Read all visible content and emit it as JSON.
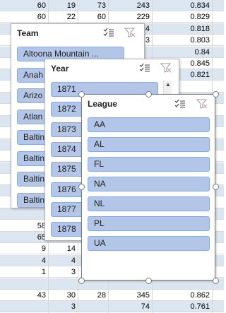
{
  "grid": {
    "rows": [
      {
        "c1": "60",
        "c2": "19",
        "c3": "73",
        "c4": "243",
        "c5": "0.834"
      },
      {
        "c1": "60",
        "c2": "22",
        "c3": "60",
        "c4": "229",
        "c5": "0.829"
      },
      {
        "c1": "",
        "c2": "",
        "c3": "",
        "c4": "4",
        "c5": "0.818"
      },
      {
        "c1": "",
        "c2": "",
        "c3": "",
        "c4": "3",
        "c5": "0.803"
      },
      {
        "c1": "",
        "c2": "",
        "c3": "",
        "c4": "",
        "c5": "0.84"
      },
      {
        "c1": "",
        "c2": "",
        "c3": "",
        "c4": "",
        "c5": "0.845"
      },
      {
        "c1": "",
        "c2": "",
        "c3": "",
        "c4": "",
        "c5": "0.821"
      },
      {
        "c1": "",
        "c2": "",
        "c3": "",
        "c4": "",
        "c5": ""
      },
      {
        "c1": "",
        "c2": "",
        "c3": "",
        "c4": "",
        "c5": ""
      },
      {
        "c1": "",
        "c2": "",
        "c3": "",
        "c4": "",
        "c5": ""
      },
      {
        "c1": "",
        "c2": "",
        "c3": "",
        "c4": "",
        "c5": ""
      },
      {
        "c1": "",
        "c2": "",
        "c3": "",
        "c4": "",
        "c5": ""
      },
      {
        "c1": "",
        "c2": "",
        "c3": "",
        "c4": "",
        "c5": ""
      },
      {
        "c1": "",
        "c2": "",
        "c3": "",
        "c4": "",
        "c5": ""
      },
      {
        "c1": "",
        "c2": "",
        "c3": "",
        "c4": "",
        "c5": ""
      },
      {
        "c1": "",
        "c2": "",
        "c3": "",
        "c4": "",
        "c5": ""
      },
      {
        "c1": "",
        "c2": "",
        "c3": "",
        "c4": "",
        "c5": ""
      },
      {
        "c1": "",
        "c2": "",
        "c3": "",
        "c4": "",
        "c5": ""
      },
      {
        "c1": "",
        "c2": "",
        "c3": "",
        "c4": "",
        "c5": ""
      },
      {
        "c1": "58",
        "c2": "",
        "c3": "",
        "c4": "",
        "c5": ""
      },
      {
        "c1": "65",
        "c2": "",
        "c3": "",
        "c4": "",
        "c5": ""
      },
      {
        "c1": "9",
        "c2": "14",
        "c3": "",
        "c4": "",
        "c5": ""
      },
      {
        "c1": "4",
        "c2": "4",
        "c3": "",
        "c4": "",
        "c5": ""
      },
      {
        "c1": "1",
        "c2": "3",
        "c3": "",
        "c4": "",
        "c5": ""
      },
      {
        "c1": "",
        "c2": "",
        "c3": "",
        "c4": "",
        "c5": ""
      },
      {
        "c1": "43",
        "c2": "30",
        "c3": "28",
        "c4": "345",
        "c5": "0.862"
      },
      {
        "c1": "",
        "c2": "3",
        "c3": "",
        "c4": "74",
        "c5": "0.761"
      }
    ]
  },
  "team_slicer": {
    "title": "Team",
    "items": [
      "Altoona Mountain ...",
      "Anah",
      "Arizo",
      "Atlan",
      "Baltin",
      "Baltin",
      "Baltin",
      "Baltin"
    ],
    "multiselect_icon": "multi-select-icon",
    "clear_filter_icon": "clear-filter-icon"
  },
  "year_slicer": {
    "title": "Year",
    "items": [
      "1871",
      "1872",
      "1873",
      "1874",
      "1875",
      "1876",
      "1877",
      "1878"
    ],
    "multiselect_icon": "multi-select-icon",
    "clear_filter_icon": "clear-filter-icon"
  },
  "league_slicer": {
    "title": "League",
    "items": [
      "AA",
      "AL",
      "FL",
      "NA",
      "NL",
      "PL",
      "UA"
    ],
    "multiselect_icon": "multi-select-icon",
    "clear_filter_icon": "clear-filter-icon"
  },
  "colors": {
    "band": "#dce6f1",
    "item_fill": "#b4c6e7",
    "item_border": "#8ea9db"
  }
}
